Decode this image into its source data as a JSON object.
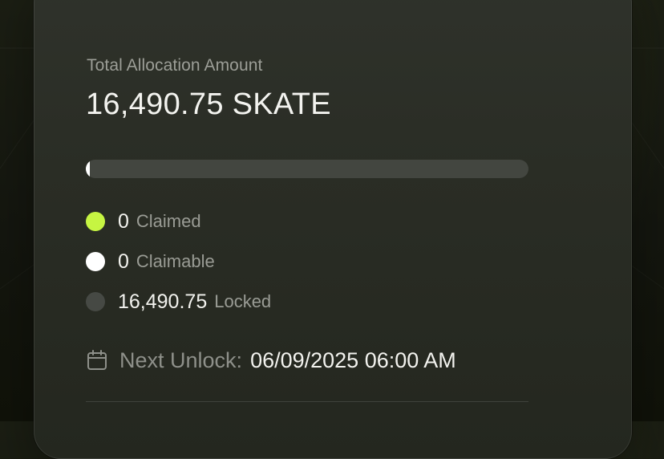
{
  "allocation": {
    "label": "Total Allocation Amount",
    "amount": "16,490.75 SKATE"
  },
  "progress": {
    "fraction": 0.0,
    "track_color": "#434640",
    "fill_color": "#ffffff"
  },
  "legend": [
    {
      "value": "0",
      "label": "Claimed",
      "color": "#c6f542"
    },
    {
      "value": "0",
      "label": "Claimable",
      "color": "#ffffff"
    },
    {
      "value": "16,490.75",
      "label": "Locked",
      "color": "#464944"
    }
  ],
  "unlock": {
    "icon": "calendar-icon",
    "label": "Next Unlock:",
    "date": "06/09/2025 06:00 AM"
  }
}
